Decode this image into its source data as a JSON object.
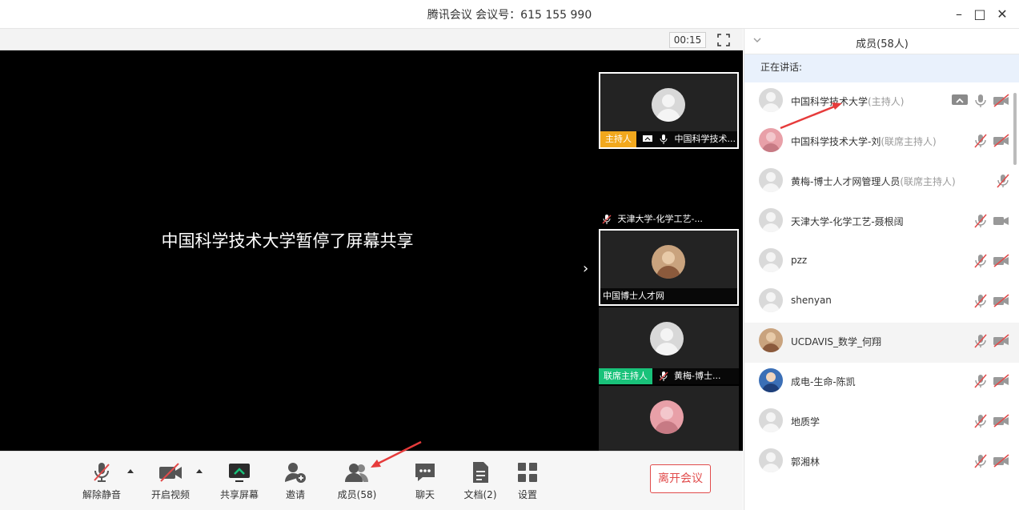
{
  "window": {
    "title": "腾讯会议 会议号：615 155 990"
  },
  "stage": {
    "timer": "00:15",
    "paused_message": "中国科学技术大学暂停了屏幕共享"
  },
  "tiles": [
    {
      "role": "主持人",
      "role_kind": "host",
      "name": "中国科学技术...",
      "icons": [
        "share-screen-icon",
        "mic-on-icon"
      ],
      "selected": true
    },
    {
      "role": "",
      "role_kind": "",
      "name": "天津大学-化学工艺-...",
      "icons": [
        "mic-muted-icon"
      ],
      "selected": false
    },
    {
      "role": "",
      "role_kind": "",
      "name": "中国博士人才网",
      "icons": [],
      "selected": true
    },
    {
      "role": "联席主持人",
      "role_kind": "co",
      "name": "黄梅-博士...",
      "icons": [
        "mic-muted-icon"
      ],
      "selected": false
    },
    {
      "role": "",
      "role_kind": "",
      "name": "",
      "icons": [],
      "selected": false
    }
  ],
  "toolbar": {
    "unmute": "解除静音",
    "start_video": "开启视频",
    "share": "共享屏幕",
    "invite": "邀请",
    "members": "成员(58)",
    "chat": "聊天",
    "docs": "文档(2)",
    "settings": "设置",
    "leave": "离开会议"
  },
  "members_panel": {
    "title": "成员(58人)",
    "speaking_label": "正在讲话:",
    "members": [
      {
        "name": "中国科学技术大学",
        "role": "(主持人)",
        "avatar": "default",
        "share": true,
        "mic": "on",
        "video": "off"
      },
      {
        "name": "中国科学技术大学-刘",
        "role": "(联席主持人)",
        "avatar": "pink",
        "share": false,
        "mic": "muted",
        "video": "off"
      },
      {
        "name": "黄梅-博士人才网管理人员",
        "role": "(联席主持人)",
        "avatar": "default",
        "share": false,
        "mic": "muted",
        "video": "none"
      },
      {
        "name": "天津大学-化学工艺-聂根阔",
        "role": "",
        "avatar": "default",
        "share": false,
        "mic": "muted",
        "video": "on"
      },
      {
        "name": "pzz",
        "role": "",
        "avatar": "default",
        "share": false,
        "mic": "muted",
        "video": "off"
      },
      {
        "name": "shenyan",
        "role": "",
        "avatar": "default",
        "share": false,
        "mic": "muted",
        "video": "off"
      },
      {
        "name": "UCDAVIS_数学_何翔",
        "role": "",
        "avatar": "tan",
        "share": false,
        "mic": "muted",
        "video": "off"
      },
      {
        "name": "成电-生命-陈凯",
        "role": "",
        "avatar": "blue",
        "share": false,
        "mic": "muted",
        "video": "off"
      },
      {
        "name": "地质学",
        "role": "",
        "avatar": "default",
        "share": false,
        "mic": "muted",
        "video": "off"
      },
      {
        "name": "郭湘林",
        "role": "",
        "avatar": "default",
        "share": false,
        "mic": "muted",
        "video": "off"
      }
    ]
  },
  "colors": {
    "host": "#f2a81d",
    "cohost": "#19c27a",
    "leave": "#e14b4b",
    "muted": "#e14b4b",
    "speaking_bg": "#e9f1fc"
  }
}
